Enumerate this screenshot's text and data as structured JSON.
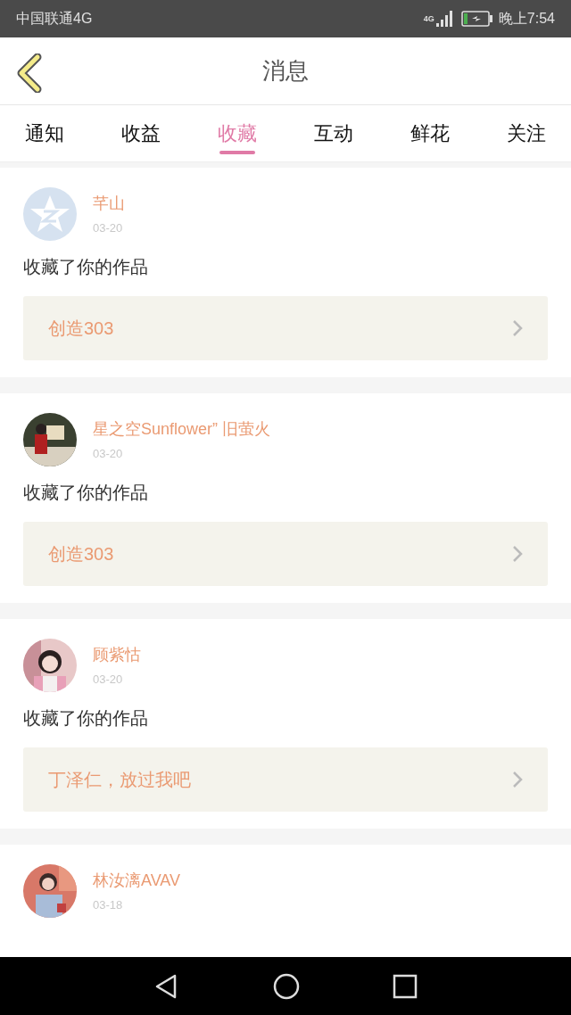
{
  "status_bar": {
    "carrier": "中国联通4G",
    "network": "4G",
    "time": "晚上7:54"
  },
  "header": {
    "title": "消息"
  },
  "tabs": [
    {
      "label": "通知",
      "selected": false
    },
    {
      "label": "收益",
      "selected": false
    },
    {
      "label": "收藏",
      "selected": true
    },
    {
      "label": "互动",
      "selected": false
    },
    {
      "label": "鲜花",
      "selected": false
    },
    {
      "label": "关注",
      "selected": false
    }
  ],
  "messages": [
    {
      "avatar": {
        "kind": "default"
      },
      "name": "芊山",
      "date": "03-20",
      "text": "收藏了你的作品",
      "work": "创造303"
    },
    {
      "name": "星之空Sunflower” 旧萤火",
      "date": "03-20",
      "text": "收藏了你的作品",
      "work": "创造303"
    },
    {
      "name": "顾紫怙",
      "date": "03-20",
      "text": "收藏了你的作品",
      "work": "丁泽仁，放过我吧"
    },
    {
      "name": "林汝漓AVAV",
      "date": "03-18"
    }
  ]
}
